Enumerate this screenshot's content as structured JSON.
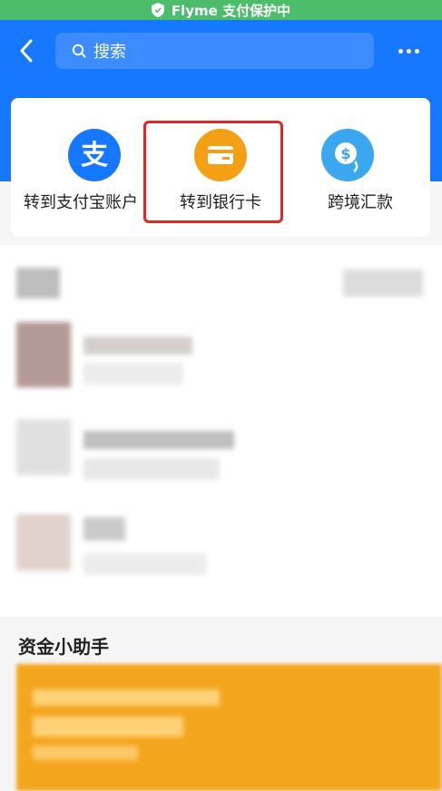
{
  "status_bar": {
    "text": "Flyme 支付保护中",
    "color": "#4cbd6b"
  },
  "header": {
    "back_icon": "chevron-left-icon",
    "search_placeholder": "搜索",
    "more_icon": "more-dots-icon",
    "color": "#1677ff"
  },
  "actions": [
    {
      "label": "转到支付宝账户",
      "icon": "alipay-icon",
      "color": "#1677ff"
    },
    {
      "label": "转到银行卡",
      "icon": "bank-card-icon",
      "color": "#f3a014",
      "highlighted": true
    },
    {
      "label": "跨境汇款",
      "icon": "cross-border-remittance-icon",
      "color": "#3aa7ef"
    }
  ],
  "assistant": {
    "title": "资金小助手"
  }
}
